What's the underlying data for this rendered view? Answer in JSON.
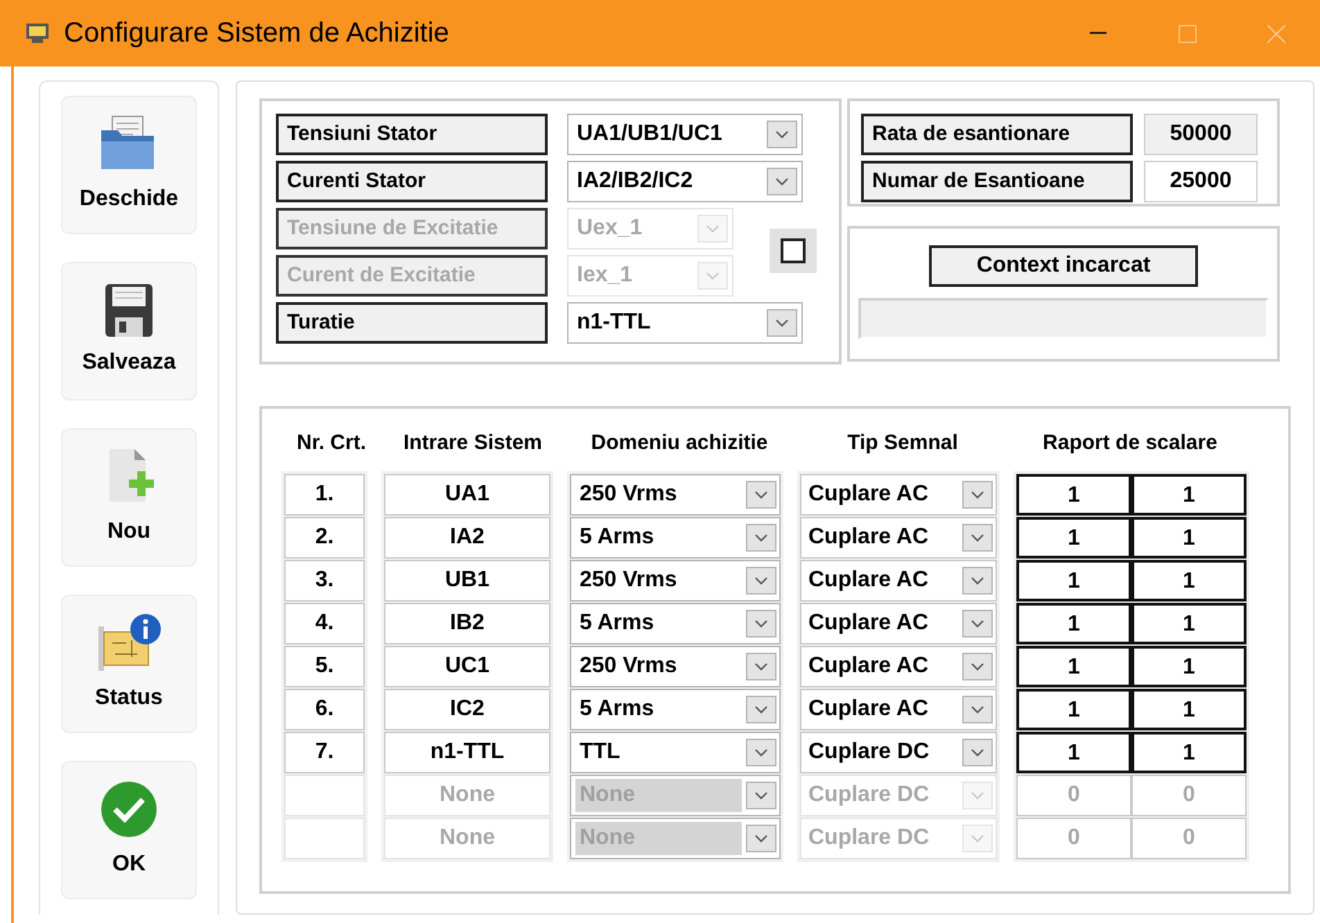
{
  "window": {
    "title": "Configurare Sistem de Achizitie"
  },
  "toolbar": [
    {
      "kind": "open",
      "label": "Deschide"
    },
    {
      "kind": "save",
      "label": "Salveaza"
    },
    {
      "kind": "new",
      "label": "Nou"
    },
    {
      "kind": "status",
      "label": "Status"
    },
    {
      "kind": "ok",
      "label": "OK"
    }
  ],
  "channel_map": [
    {
      "label": "Tensiuni Stator",
      "value": "UA1/UB1/UC1",
      "disabled": false
    },
    {
      "label": "Curenti Stator",
      "value": "IA2/IB2/IC2",
      "disabled": false
    },
    {
      "label": "Tensiune de Excitatie",
      "value": "Uex_1",
      "disabled": true
    },
    {
      "label": "Curent de Excitatie",
      "value": "Iex_1",
      "disabled": true
    },
    {
      "label": "Turatie",
      "value": "n1-TTL",
      "disabled": false
    }
  ],
  "excitation_checkbox": {
    "checked": false
  },
  "sampling": [
    {
      "label": "Rata de esantionare",
      "value": "50000",
      "readonly": true
    },
    {
      "label": "Numar de Esantioane",
      "value": "25000",
      "readonly": false
    }
  ],
  "context": {
    "label": "Context incarcat",
    "level": 0
  },
  "table": {
    "columns": [
      "Nr. Crt.",
      "Intrare Sistem",
      "Domeniu achizitie",
      "Tip Semnal",
      "Raport de scalare"
    ],
    "rows": [
      {
        "nr": "1.",
        "input": "UA1",
        "range": "250 Vrms",
        "signal": "Cuplare AC",
        "scale_1": "1",
        "scale_2": "1",
        "disabled": false
      },
      {
        "nr": "2.",
        "input": "IA2",
        "range": "5 Arms",
        "signal": "Cuplare AC",
        "scale_1": "1",
        "scale_2": "1",
        "disabled": false
      },
      {
        "nr": "3.",
        "input": "UB1",
        "range": "250 Vrms",
        "signal": "Cuplare AC",
        "scale_1": "1",
        "scale_2": "1",
        "disabled": false
      },
      {
        "nr": "4.",
        "input": "IB2",
        "range": "5 Arms",
        "signal": "Cuplare AC",
        "scale_1": "1",
        "scale_2": "1",
        "disabled": false
      },
      {
        "nr": "5.",
        "input": "UC1",
        "range": "250 Vrms",
        "signal": "Cuplare AC",
        "scale_1": "1",
        "scale_2": "1",
        "disabled": false
      },
      {
        "nr": "6.",
        "input": "IC2",
        "range": "5 Arms",
        "signal": "Cuplare AC",
        "scale_1": "1",
        "scale_2": "1",
        "disabled": false
      },
      {
        "nr": "7.",
        "input": "n1-TTL",
        "range": "TTL",
        "signal": "Cuplare DC",
        "scale_1": "1",
        "scale_2": "1",
        "disabled": false
      },
      {
        "input": "None",
        "range": "None",
        "signal": "Cuplare DC",
        "scale_1": "0",
        "scale_2": "0",
        "disabled": true
      },
      {
        "input": "None",
        "range": "None",
        "signal": "Cuplare DC",
        "scale_1": "0",
        "scale_2": "0",
        "disabled": true
      }
    ]
  }
}
